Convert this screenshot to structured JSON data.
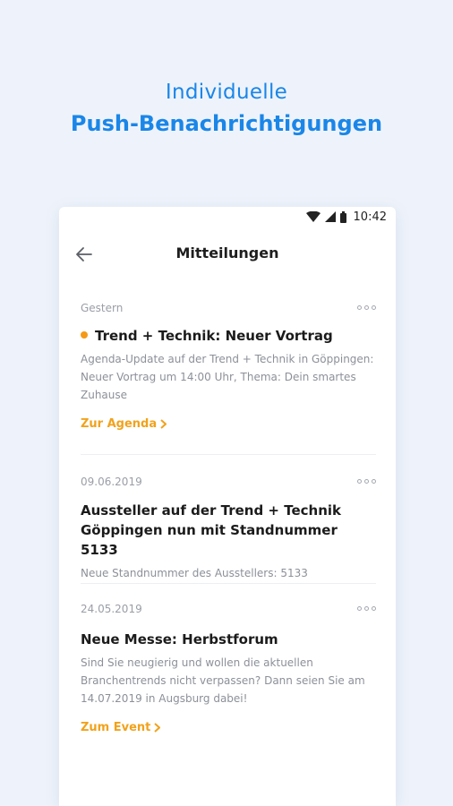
{
  "headline": {
    "line1": "Individuelle",
    "line2": "Push-Benachrichtigungen"
  },
  "status_bar": {
    "time": "10:42",
    "icons": [
      "wifi-icon",
      "signal-icon",
      "battery-icon"
    ]
  },
  "app_bar": {
    "title": "Mitteilungen",
    "back_icon": "arrow-left-icon"
  },
  "notifications": [
    {
      "date": "Gestern",
      "unread": true,
      "title": "Trend + Technik: Neuer Vortrag",
      "body": "Agenda-Update auf der Trend + Technik in Göppingen: Neuer Vortrag um 14:00 Uhr, Thema: Dein smartes Zuhause",
      "link": "Zur Agenda"
    },
    {
      "date": "09.06.2019",
      "unread": false,
      "title": "Aussteller auf der Trend + Technik Göppingen nun mit Standnummer 5133",
      "body": "Neue Standnummer des Ausstellers: 5133"
    },
    {
      "date": "24.05.2019",
      "unread": false,
      "title": "Neue Messe: Herbstforum",
      "body": "Sind Sie neugierig und wollen die aktuellen Branchentrends nicht verpassen? Dann seien Sie am 14.07.2019 in Augsburg dabei!",
      "link": "Zum Event"
    }
  ],
  "colors": {
    "accent_blue": "#1a86e8",
    "link_orange": "#f2a21b",
    "unread_dot": "#f49a16",
    "background": "#eef3fb"
  }
}
